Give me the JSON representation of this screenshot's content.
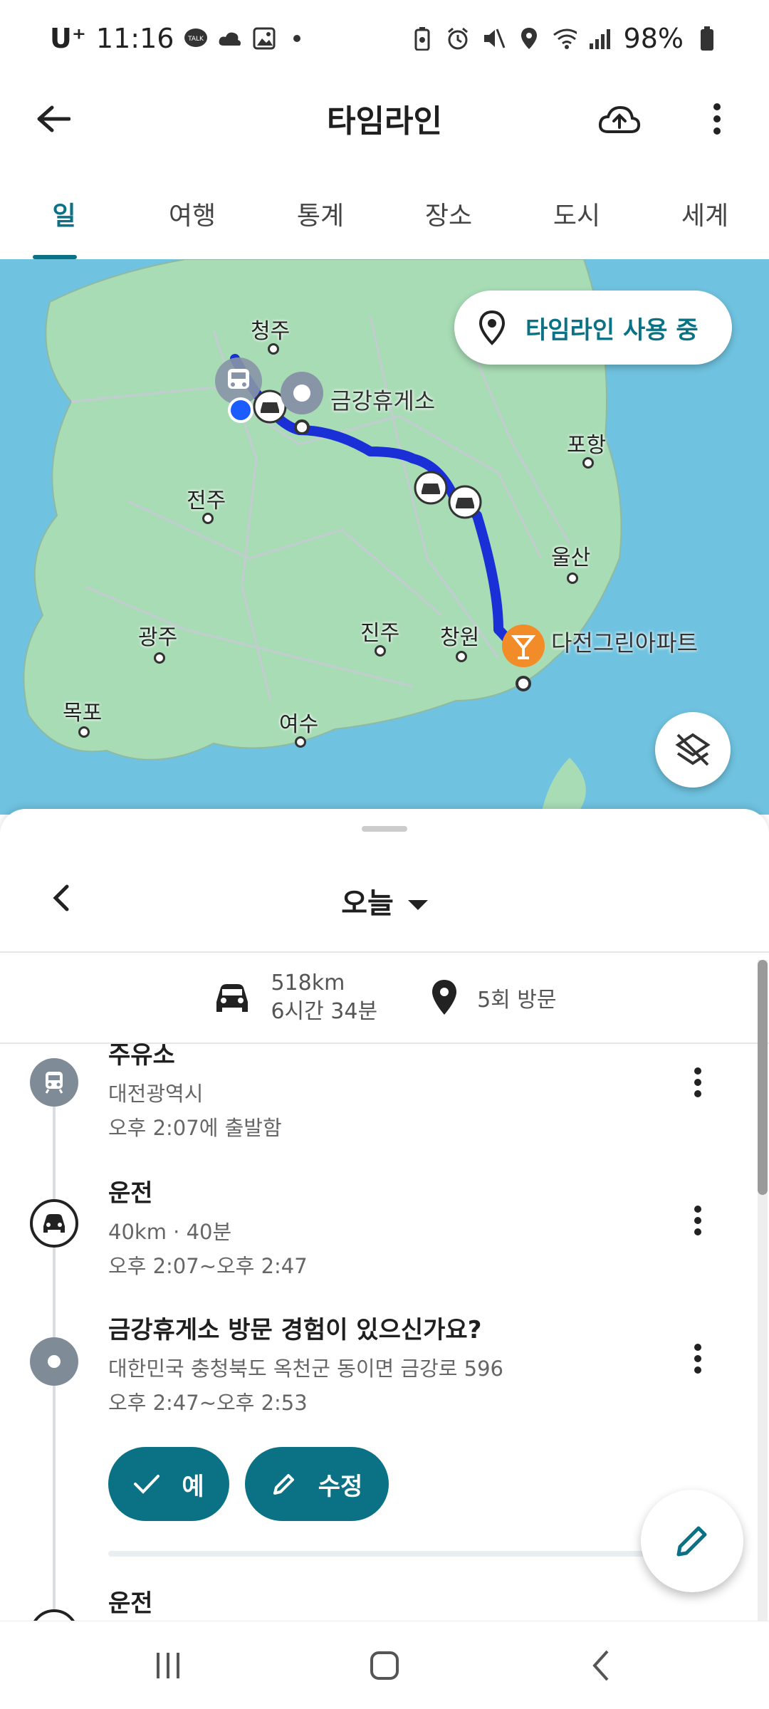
{
  "status_bar": {
    "carrier": "U⁺",
    "time": "11:16",
    "battery": "98%",
    "icons": [
      "talk-icon",
      "cloud-icon",
      "gallery-icon",
      "dot-icon",
      "battery-saver-icon",
      "alarm-icon",
      "mute-icon",
      "location-icon",
      "wifi-icon",
      "signal-icon",
      "battery-icon"
    ]
  },
  "app_bar": {
    "title": "타임라인",
    "icons": [
      "back-arrow-icon",
      "cloud-upload-icon",
      "more-vert-icon"
    ]
  },
  "tabs": [
    {
      "label": "일",
      "active": true
    },
    {
      "label": "여행",
      "active": false
    },
    {
      "label": "통계",
      "active": false
    },
    {
      "label": "장소",
      "active": false
    },
    {
      "label": "도시",
      "active": false
    },
    {
      "label": "세계",
      "active": false
    }
  ],
  "map": {
    "chip_label": "타임라인 사용 중",
    "cities": [
      "청주",
      "포항",
      "전주",
      "울산",
      "광주",
      "진주",
      "창원",
      "목포",
      "여수"
    ],
    "pins": {
      "rest_area": "금강휴게소",
      "destination": "다전그린아파트"
    },
    "route_color": "#1a2fd6",
    "accent_color": "#f28c28"
  },
  "sheet": {
    "date_label": "오늘",
    "summary": {
      "distance": "518km",
      "duration": "6시간 34분",
      "visits": "5회 방문"
    },
    "entries": [
      {
        "title": "주유소",
        "line1": "대전광역시",
        "line2": "오후 2:07에 출발함",
        "icon": "train-icon"
      },
      {
        "title": "운전",
        "line1": "40km · 40분",
        "line2": "오후 2:07~오후 2:47",
        "icon": "car-icon"
      },
      {
        "title": "금강휴게소 방문 경험이 있으신가요?",
        "line1": "대한민국 충청북도 옥천군 동이면 금강로 596",
        "line2": "오후 2:47~오후 2:53",
        "icon": "place-dot-icon"
      },
      {
        "title": "운전",
        "icon": "car-icon"
      }
    ],
    "buttons": {
      "yes": "예",
      "edit": "수정"
    }
  },
  "theme": {
    "accent": "#0b7285",
    "map_water": "#6fc3e0",
    "map_land": "#a8dcb5"
  }
}
